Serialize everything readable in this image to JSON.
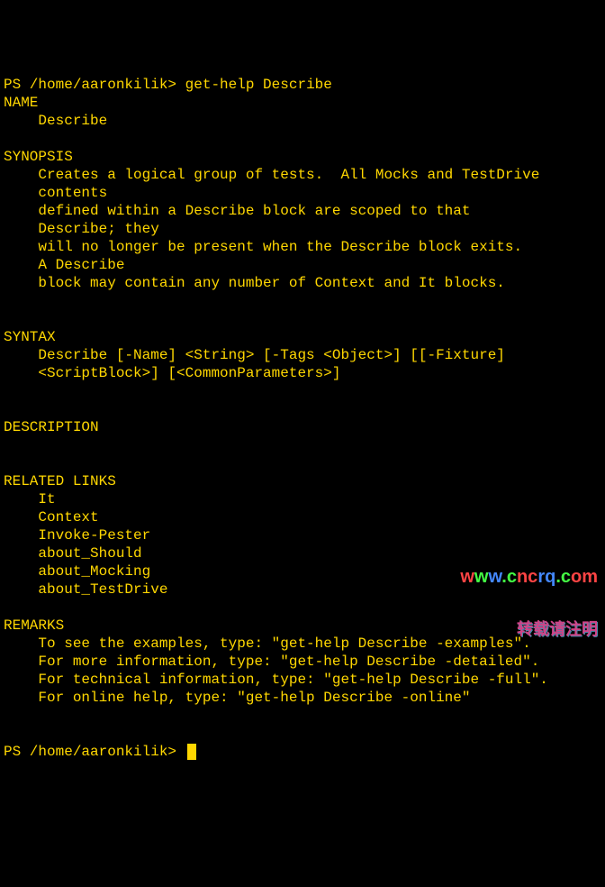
{
  "prompt1": "PS /home/aaronkilik> ",
  "command": "get-help Describe",
  "output": "\nNAME\n    Describe\n    \nSYNOPSIS\n    Creates a logical group of tests.  All Mocks and TestDrive \n    contents\n    defined within a Describe block are scoped to that \n    Describe; they\n    will no longer be present when the Describe block exits.  \n    A Describe\n    block may contain any number of Context and It blocks.\n    \n    \nSYNTAX\n    Describe [-Name] <String> [-Tags <Object>] [[-Fixture] \n    <ScriptBlock>] [<CommonParameters>]\n    \n    \nDESCRIPTION\n    \n\nRELATED LINKS\n    It \n    Context \n    Invoke-Pester \n    about_Should \n    about_Mocking \n    about_TestDrive \n\nREMARKS\n    To see the examples, type: \"get-help Describe -examples\".\n    For more information, type: \"get-help Describe -detailed\".\n    For technical information, type: \"get-help Describe -full\".\n    For online help, type: \"get-help Describe -online\"\n\n\n",
  "prompt2": "PS /home/aaronkilik> ",
  "watermark": {
    "url_chars": [
      "w",
      "w",
      "w",
      ".c",
      "nc",
      "rq",
      ".c",
      "om"
    ],
    "text": "转载请注明"
  }
}
